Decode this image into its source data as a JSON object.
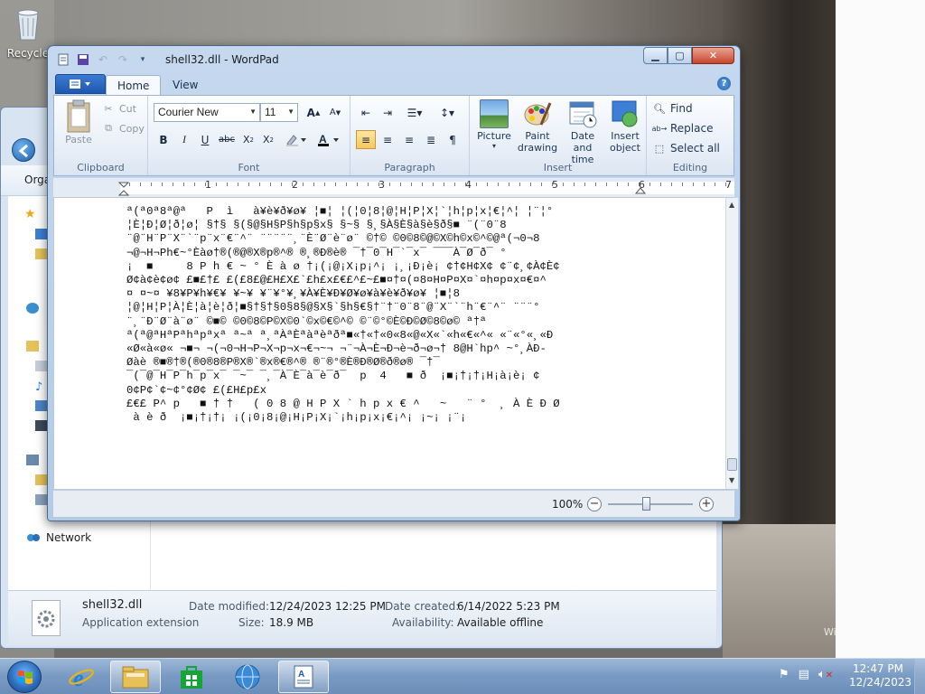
{
  "desktop": {
    "recycle_bin_label": "Recycle",
    "watermark": "Wi"
  },
  "explorer": {
    "organize_label": "Orga",
    "network_label": "Network",
    "details": {
      "file_name": "shell32.dll",
      "file_type": "Application extension",
      "date_modified_label": "Date modified:",
      "date_modified": "12/24/2023 12:25 PM",
      "size_label": "Size:",
      "size": "18.9 MB",
      "date_created_label": "Date created:",
      "date_created": "6/14/2022 5:23 PM",
      "availability_label": "Availability:",
      "availability": "Available offline"
    }
  },
  "wordpad": {
    "title": "shell32.dll - WordPad",
    "tabs": {
      "home": "Home",
      "view": "View"
    },
    "clipboard": {
      "paste": "Paste",
      "cut": "Cut",
      "copy": "Copy",
      "label": "Clipboard"
    },
    "font": {
      "name": "Courier New",
      "size": "11",
      "label": "Font"
    },
    "paragraph": {
      "label": "Paragraph"
    },
    "insert": {
      "picture": "Picture",
      "paint_1": "Paint",
      "paint_2": "drawing",
      "datetime_1": "Date and",
      "datetime_2": "time",
      "object_1": "Insert",
      "object_2": "object",
      "label": "Insert"
    },
    "editing": {
      "find": "Find",
      "replace": "Replace",
      "select_all": "Select all",
      "label": "Editing"
    },
    "ruler_numbers": [
      "1",
      "2",
      "3",
      "4",
      "5",
      "6",
      "7"
    ],
    "document_text": "ª(ª0ª8ª@ª   P  ì   à¥è¥ð¥ø¥ ¦■¦ ¦(¦0¦8¦@¦H¦P¦X¦`¦h¦p¦x¦€¦^¦ ¦¨¦°\n¦È¦Ð¦Ø¦ð¦ø¦ §†§ §(§@§H§P§h§p§x§ §~§ §¸§À§È§à§è§ð§■ ¨(¨0¨8\n¨@¨H¨P¨X¨`¨p¨x¨€¨^¨ ¨¨¨¨¨¸¨È¨Ø¨è¨ø¨ ©†© ©0©8©@©X©h©x©^©@ª(¬0¬8\n¬@¬H¬Ph€~°Èàø†®(®@®X®p®^® ®¸®Ð®è® ¯†¯0¯H¯`¯x¯ ¯¯¯À¯Ø¯ð¯ °\n¡  ■     8 P h € ~ ° È à ø †¡(¡@¡X¡p¡^¡ ¡¸¡Ð¡è¡ ¢†¢H¢X¢ ¢¨¢¸¢À¢È¢\nØ¢à¢è¢ø¢ £■£†£ £(£8£@£H£X£`£h£x£€£^£~£■¤†¤(¤8¤H¤P¤X¤`¤h¤p¤x¤€¤^\n¤ ¤~¤ ¥8¥P¥h¥€¥ ¥~¥ ¥¨¥°¥¸¥À¥È¥Ð¥Ø¥ø¥à¥è¥ð¥ø¥ ¦■¦8\n¦@¦H¦P¦À¦È¦à¦è¦ð¦■§†§†§0§8§@§X§`§h§€§†¨†¨0¨8¨@¨X¨`¨h¨€¨^¨ ¨¨¨°\n¨¸¨Ð¨Ø¨à¨ø¨ ©■© ©0©8©P©X©0`©x©€©^© ©¨©°©È©Ð©Ø©8©ø© ª†ª\nª(ª@ªHªPªhªpªxª ª~ª ª¸ªÀªÈªàªèªðª■«†«†«0«8«@«X«`«h«€«^« «¨«°«¸«Ð\n«Ø«à«ø« ¬■¬ ¬(¬0¬H¬P¬X¬p¬x¬€¬~¬ ¬¨¬À¬È¬Ð¬è¬ð¬ø¬†­ 8@H`hp^ ~°¸ÀÐ-\nØàè ®■®†®(®0®8®P®X®`®x®€®^® ®¨®°®È®Ð®Ø®ð®ø® ¯†¯\n¯(¯@¯H¯P¯h¯p¯x¯ ¯~¯ ¯¸¯À¯È¯à¯è¯ð¯  p  4   ■ ð  ¡■¡†¡†¡H¡à¡è¡ ¢\n0¢P¢`¢~¢°¢Ø¢ £(£H£p£x\n£€£ P^ p   ■ † †   ( 0 8 @ H P X ` h p x € ^   ~   ¨ °  ¸ À È Ð Ø\n à è ð  ¡■¡†¡†¡ ¡(¡0¡8¡@¡H¡P¡X¡`¡h¡p¡x¡€¡^¡ ¡~¡ ¡¨¡",
    "zoom": "100%"
  },
  "taskbar": {
    "time": "12:47 PM",
    "date": "12/24/2023"
  },
  "colors": {
    "accent": "#1f58ae",
    "selected_button": "#f7c75a",
    "close_button": "#c7462c"
  }
}
